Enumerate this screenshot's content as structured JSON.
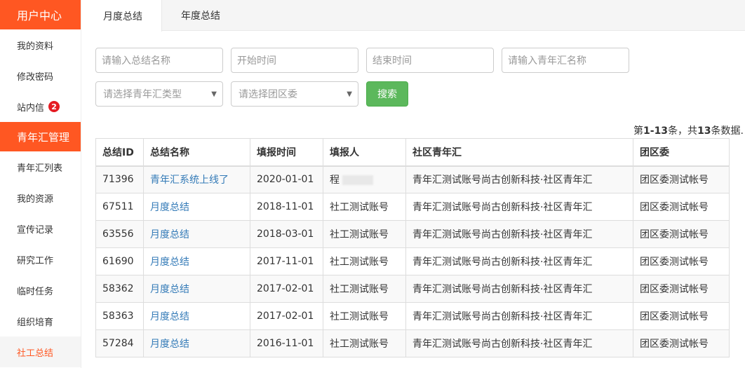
{
  "sidebar": {
    "section1": "用户中心",
    "section1_items": [
      {
        "label": "我的资料"
      },
      {
        "label": "修改密码"
      },
      {
        "label": "站内信",
        "badge": "2"
      }
    ],
    "section2": "青年汇管理",
    "section2_items": [
      {
        "label": "青年汇列表"
      },
      {
        "label": "我的资源"
      },
      {
        "label": "宣传记录"
      },
      {
        "label": "研究工作"
      },
      {
        "label": "临时任务"
      },
      {
        "label": "组织培育"
      },
      {
        "label": "社工总结"
      }
    ]
  },
  "tabs": [
    "月度总结",
    "年度总结"
  ],
  "filters": {
    "name_placeholder": "请输入总结名称",
    "start_placeholder": "开始时间",
    "end_placeholder": "结束时间",
    "center_placeholder": "请输入青年汇名称",
    "type_placeholder": "请选择青年汇类型",
    "district_placeholder": "请选择团区委",
    "search_label": "搜索"
  },
  "summary": {
    "prefix": "第",
    "range": "1-13",
    "mid": "条，共",
    "total": "13",
    "suffix": "条数据."
  },
  "table": {
    "headers": [
      "总结ID",
      "总结名称",
      "填报时间",
      "填报人",
      "社区青年汇",
      "团区委"
    ],
    "rows": [
      [
        "71396",
        "青年汇系统上线了",
        "2020-01-01",
        "程",
        "青年汇测试账号尚古创新科技·社区青年汇",
        "团区委测试帐号"
      ],
      [
        "67511",
        "月度总结",
        "2018-11-01",
        "社工测试账号",
        "青年汇测试账号尚古创新科技·社区青年汇",
        "团区委测试帐号"
      ],
      [
        "63556",
        "月度总结",
        "2018-03-01",
        "社工测试账号",
        "青年汇测试账号尚古创新科技·社区青年汇",
        "团区委测试帐号"
      ],
      [
        "61690",
        "月度总结",
        "2017-11-01",
        "社工测试账号",
        "青年汇测试账号尚古创新科技·社区青年汇",
        "团区委测试帐号"
      ],
      [
        "58362",
        "月度总结",
        "2017-02-01",
        "社工测试账号",
        "青年汇测试账号尚古创新科技·社区青年汇",
        "团区委测试帐号"
      ],
      [
        "58363",
        "月度总结",
        "2017-02-01",
        "社工测试账号",
        "青年汇测试账号尚古创新科技·社区青年汇",
        "团区委测试帐号"
      ],
      [
        "57284",
        "月度总结",
        "2016-11-01",
        "社工测试账号",
        "青年汇测试账号尚古创新科技·社区青年汇",
        "团区委测试帐号"
      ]
    ]
  }
}
